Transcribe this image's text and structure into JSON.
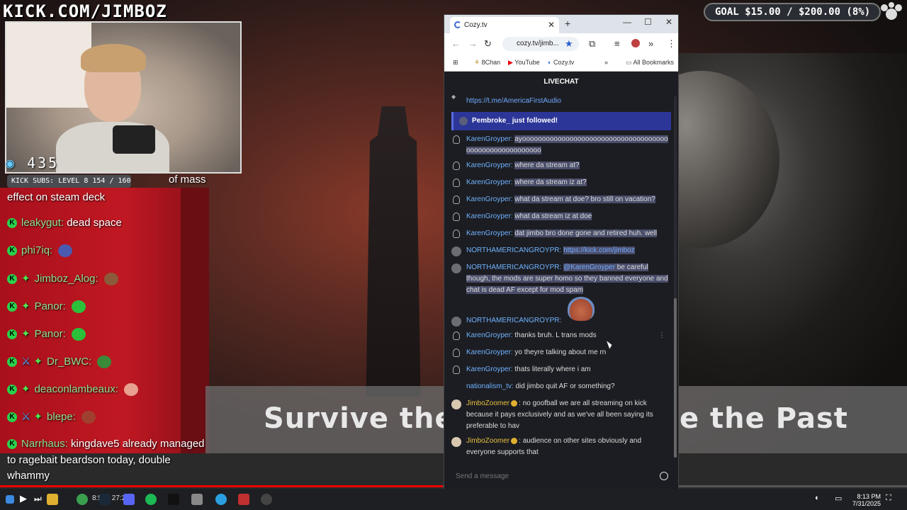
{
  "overlay": {
    "kick_url": "KICK.COM/JIMBOZ",
    "goal": "GOAL $15.00 / $200.00 (8%)",
    "viewer_count": "435",
    "kick_subs": "KICK SUBS: LEVEL 8 154 / 160",
    "video_title_left": "Survive the",
    "video_title_right": "e the Past"
  },
  "left_chat": [
    {
      "user": "",
      "text": "of mass"
    },
    {
      "user": "",
      "text": "effect on steam deck"
    },
    {
      "user": "leakygut:",
      "text": "dead space",
      "emote": false
    },
    {
      "user": "phi7iq:",
      "text": "",
      "emote": true,
      "emote_color": "#4a5ab0"
    },
    {
      "user": "Jimboz_Alog:",
      "text": "",
      "emote": true,
      "emote_color": "#8a5a3a"
    },
    {
      "user": "Panor:",
      "text": "",
      "emote": true,
      "emote_color": "#2ac03a"
    },
    {
      "user": "Panor:",
      "text": "",
      "emote": true,
      "emote_color": "#2ac03a"
    },
    {
      "user": "Dr_BWC:",
      "text": "",
      "emote": true,
      "emote_color": "#3a8a3a"
    },
    {
      "user": "deaconlambeaux:",
      "text": "",
      "emote": true,
      "emote_color": "#e8a090"
    },
    {
      "user": "blepe:",
      "text": "",
      "emote": true,
      "emote_color": "#a04030"
    },
    {
      "user": "Narrhaus:",
      "text": "kingdave5 already managed"
    },
    {
      "user": "",
      "text": "to ragebait beardson today, double"
    },
    {
      "user": "",
      "text": "whammy"
    }
  ],
  "browser": {
    "tab_title": "Cozy.tv",
    "url": "cozy.tv/jimb...",
    "bookmarks": [
      "8Chan",
      "YouTube",
      "Cozy.tv"
    ],
    "all_bookmarks": "All Bookmarks"
  },
  "chat": {
    "header": "LIVECHAT",
    "top_link": "https://t.me/AmericaFirstAudio",
    "followed": "Pembroke_ just followed!",
    "messages": [
      {
        "user": "KarenGroyper:",
        "text": "ayoooooooooooooooooooooooooooooooooooooooooooooooooooooooo",
        "hl": true
      },
      {
        "user": "KarenGroyper:",
        "text": "where da stream at?",
        "hl": true
      },
      {
        "user": "KarenGroyper:",
        "text": "where da stream iz at?",
        "hl": true
      },
      {
        "user": "KarenGroyper:",
        "text": "what da stream at doe? bro still on vacation?",
        "hl": true
      },
      {
        "user": "KarenGroyper:",
        "text": "what da stream iz at doe",
        "hl": true
      },
      {
        "user": "KarenGroyper:",
        "text": "dat jimbo bro done gone and retired huh. well",
        "hl": true
      },
      {
        "user": "NORTHAMERICANGROYPR:",
        "text": "https://kick.com/jimboz",
        "hl": true
      },
      {
        "user": "NORTHAMERICANGROYPR:",
        "mention": "@KarenGroyper",
        "text": " be careful though, the mods are super homo so they banned everyone and chat is dead AF except for mod spam",
        "hl": true
      },
      {
        "user": "NORTHAMERICANGROYPR:",
        "text": ""
      },
      {
        "user": "KarenGroyper:",
        "text": "thanks bruh. L trans mods"
      },
      {
        "user": "KarenGroyper:",
        "text": "yo theyre talking about me rn"
      },
      {
        "user": "KarenGroyper:",
        "text": "thats literally where i am"
      },
      {
        "user": "nationalism_tv:",
        "text": "did jimbo quit AF or something?"
      },
      {
        "user": "JimboZoomer",
        "text": ": no goofball we are all streaming on kick because it pays exclusively and as we've all been saying its preferable to hav"
      },
      {
        "user": "JimboZoomer",
        "text": ": audience on other sites obviously and everyone supports that"
      }
    ],
    "input_placeholder": "Send a message"
  },
  "taskbar": {
    "time": "8:13 PM",
    "date": "7/31/2025",
    "player_time": "8:52 / 27:24"
  }
}
